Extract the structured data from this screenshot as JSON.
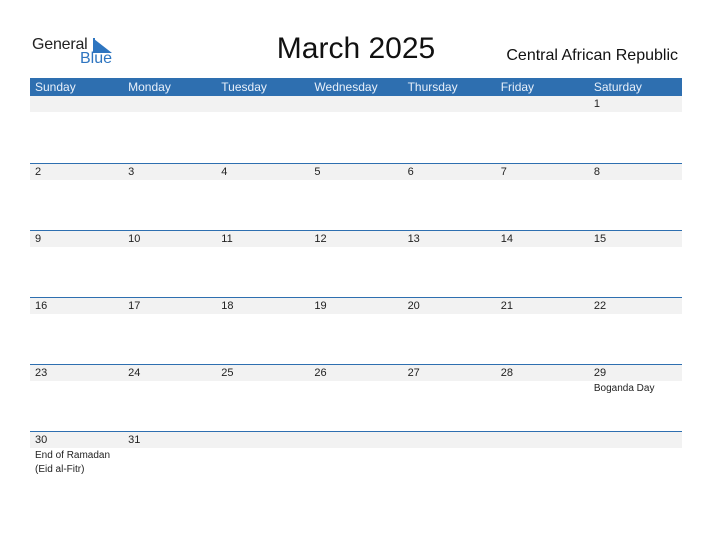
{
  "logo": {
    "word1": "General",
    "word2": "Blue"
  },
  "title": "March 2025",
  "country": "Central African Republic",
  "colors": {
    "accent": "#2e6fb0",
    "cell_header_bg": "#f2f2f2"
  },
  "weekdays": [
    "Sunday",
    "Monday",
    "Tuesday",
    "Wednesday",
    "Thursday",
    "Friday",
    "Saturday"
  ],
  "weeks": [
    [
      {
        "day": ""
      },
      {
        "day": ""
      },
      {
        "day": ""
      },
      {
        "day": ""
      },
      {
        "day": ""
      },
      {
        "day": ""
      },
      {
        "day": "1"
      }
    ],
    [
      {
        "day": "2"
      },
      {
        "day": "3"
      },
      {
        "day": "4"
      },
      {
        "day": "5"
      },
      {
        "day": "6"
      },
      {
        "day": "7"
      },
      {
        "day": "8"
      }
    ],
    [
      {
        "day": "9"
      },
      {
        "day": "10"
      },
      {
        "day": "11"
      },
      {
        "day": "12"
      },
      {
        "day": "13"
      },
      {
        "day": "14"
      },
      {
        "day": "15"
      }
    ],
    [
      {
        "day": "16"
      },
      {
        "day": "17"
      },
      {
        "day": "18"
      },
      {
        "day": "19"
      },
      {
        "day": "20"
      },
      {
        "day": "21"
      },
      {
        "day": "22"
      }
    ],
    [
      {
        "day": "23"
      },
      {
        "day": "24"
      },
      {
        "day": "25"
      },
      {
        "day": "26"
      },
      {
        "day": "27"
      },
      {
        "day": "28"
      },
      {
        "day": "29",
        "events": [
          "Boganda Day"
        ]
      }
    ],
    [
      {
        "day": "30",
        "events": [
          "End of Ramadan",
          "(Eid al-Fitr)"
        ]
      },
      {
        "day": "31"
      },
      {
        "day": ""
      },
      {
        "day": ""
      },
      {
        "day": ""
      },
      {
        "day": ""
      },
      {
        "day": ""
      }
    ]
  ]
}
